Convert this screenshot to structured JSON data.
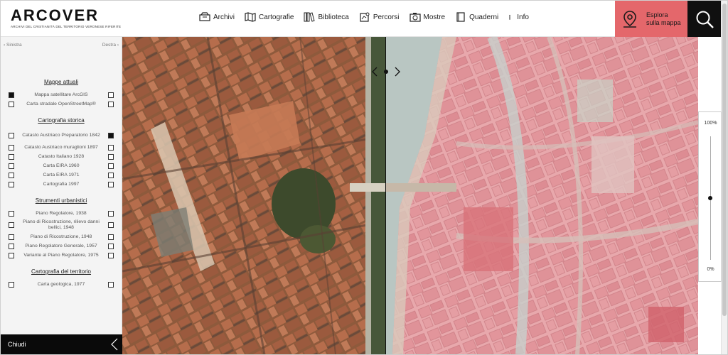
{
  "brand": {
    "title": "ARCOVER",
    "subtitle": "ARCHIVI DEL CRISTIANITÀ DEL TERRITORIO VERONESE RIFERITE"
  },
  "nav": [
    {
      "label": "Archivi",
      "icon": "archive-icon"
    },
    {
      "label": "Cartografie",
      "icon": "map-icon"
    },
    {
      "label": "Biblioteca",
      "icon": "books-icon"
    },
    {
      "label": "Percorsi",
      "icon": "route-icon"
    },
    {
      "label": "Mostre",
      "icon": "camera-icon"
    },
    {
      "label": "Quaderni",
      "icon": "notebook-icon"
    },
    {
      "label": "Info",
      "icon": "info-icon"
    }
  ],
  "explore": {
    "line1": "Esplora",
    "line2": "sulla mappa",
    "icon": "map-pin-icon"
  },
  "search": {
    "icon": "search-icon"
  },
  "sidebar": {
    "left_label": "Sinistra",
    "right_label": "Destra",
    "close_label": "Chiudi",
    "sections": [
      {
        "title": "Mappe attuali",
        "layers": [
          {
            "label": "Mappa satellitare ArcGIS",
            "left": true,
            "right": false
          },
          {
            "label": "Carta stradale OpenStreetMap®",
            "left": false,
            "right": false
          }
        ]
      },
      {
        "title": "Cartografia storica",
        "layers": [
          {
            "label": "Catasto Austriaco Preparatorio 1842",
            "left": false,
            "right": true
          },
          {
            "label": "Catasto Austriaco muraglioni 1897",
            "left": false,
            "right": false
          },
          {
            "label": "Catasto Italiano 1928",
            "left": false,
            "right": false
          },
          {
            "label": "Carta EIRA 1960",
            "left": false,
            "right": false
          },
          {
            "label": "Carta EIRA 1971",
            "left": false,
            "right": false
          },
          {
            "label": "Cartografia 1997",
            "left": false,
            "right": false
          }
        ]
      },
      {
        "title": "Strumenti urbanistici",
        "layers": [
          {
            "label": "Piano Regolatore, 1938",
            "left": false,
            "right": false
          },
          {
            "label": "Piano di Ricostruzione, rilievo danni bellici, 1948",
            "left": false,
            "right": false
          },
          {
            "label": "Piano di Ricostruzione, 1948",
            "left": false,
            "right": false
          },
          {
            "label": "Piano Regolatore Generale, 1957",
            "left": false,
            "right": false
          },
          {
            "label": "Variante al Piano Regolatore, 1975",
            "left": false,
            "right": false
          }
        ]
      },
      {
        "title": "Cartografia del territorio",
        "layers": [
          {
            "label": "Carta geologica, 1977",
            "left": false,
            "right": false
          }
        ]
      }
    ]
  },
  "opacity": {
    "max_label": "100%",
    "min_label": "0%",
    "value_percent": 50
  },
  "colors": {
    "accent": "#e4676b",
    "dark": "#101010",
    "sidebar_bg": "#f4f4f4"
  }
}
